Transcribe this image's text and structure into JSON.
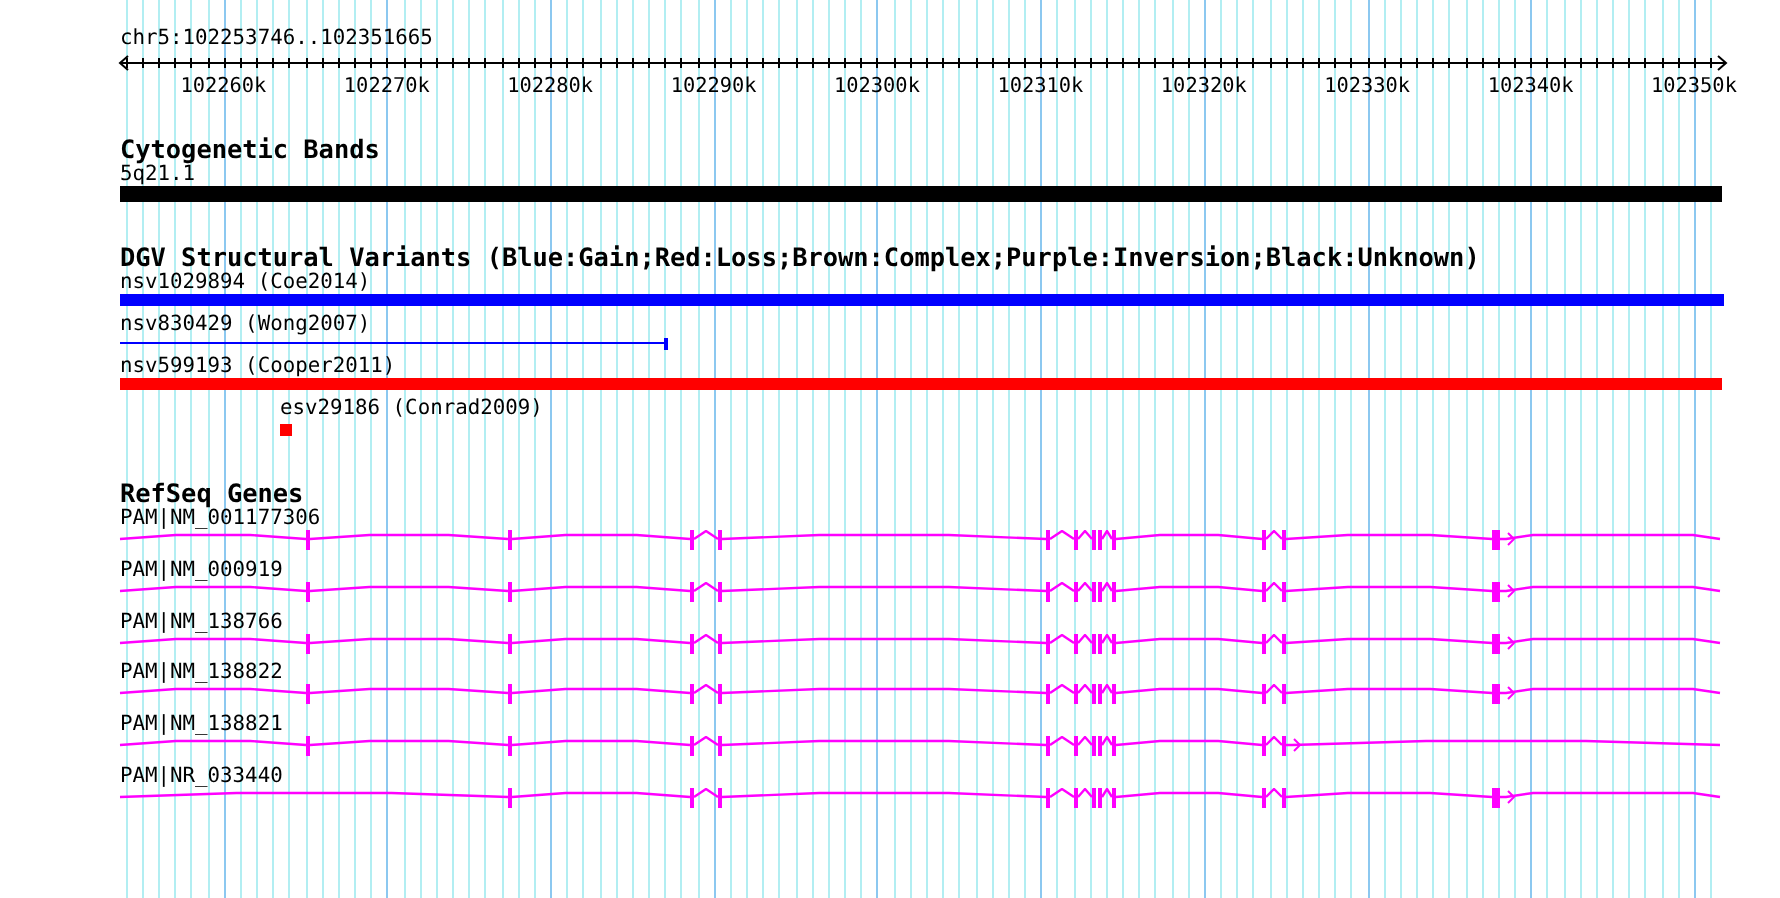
{
  "ruler": {
    "location": "chr5:102253746..102351665",
    "ticks": [
      "102260k",
      "102270k",
      "102280k",
      "102290k",
      "102300k",
      "102310k",
      "102320k",
      "102330k",
      "102340k",
      "102350k"
    ]
  },
  "tracks": [
    {
      "kind": "bands",
      "title": "Cytogenetic Bands",
      "features": [
        {
          "label": "5q21.1"
        }
      ]
    },
    {
      "kind": "variants",
      "title": "DGV Structural Variants (Blue:Gain;Red:Loss;Brown:Complex;Purple:Inversion;Black:Unknown)",
      "features": [
        {
          "label": "nsv1029894 (Coe2014)",
          "color": "#0000ff",
          "kind": "bar"
        },
        {
          "label": "nsv830429 (Wong2007)",
          "color": "#0000ff",
          "kind": "line"
        },
        {
          "label": "nsv599193 (Cooper2011)",
          "color": "#ff0000",
          "kind": "bar"
        },
        {
          "label": "esv29186 (Conrad2009)",
          "color": "#ff0000",
          "kind": "bar"
        }
      ]
    },
    {
      "kind": "genes",
      "title": "RefSeq Genes",
      "features": [
        {
          "label": "PAM|NM_001177306"
        },
        {
          "label": "PAM|NM_000919"
        },
        {
          "label": "PAM|NM_138766"
        },
        {
          "label": "PAM|NM_138822"
        },
        {
          "label": "PAM|NM_138821"
        },
        {
          "label": "PAM|NR_033440"
        }
      ]
    }
  ]
}
